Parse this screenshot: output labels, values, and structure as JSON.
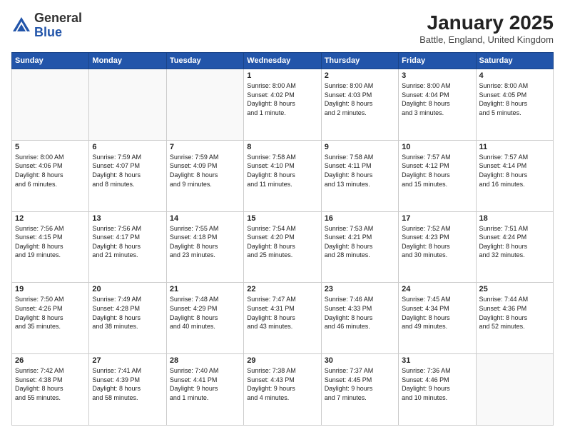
{
  "header": {
    "logo_general": "General",
    "logo_blue": "Blue",
    "month_title": "January 2025",
    "location": "Battle, England, United Kingdom"
  },
  "weekdays": [
    "Sunday",
    "Monday",
    "Tuesday",
    "Wednesday",
    "Thursday",
    "Friday",
    "Saturday"
  ],
  "weeks": [
    [
      {
        "day": "",
        "info": ""
      },
      {
        "day": "",
        "info": ""
      },
      {
        "day": "",
        "info": ""
      },
      {
        "day": "1",
        "info": "Sunrise: 8:00 AM\nSunset: 4:02 PM\nDaylight: 8 hours\nand 1 minute."
      },
      {
        "day": "2",
        "info": "Sunrise: 8:00 AM\nSunset: 4:03 PM\nDaylight: 8 hours\nand 2 minutes."
      },
      {
        "day": "3",
        "info": "Sunrise: 8:00 AM\nSunset: 4:04 PM\nDaylight: 8 hours\nand 3 minutes."
      },
      {
        "day": "4",
        "info": "Sunrise: 8:00 AM\nSunset: 4:05 PM\nDaylight: 8 hours\nand 5 minutes."
      }
    ],
    [
      {
        "day": "5",
        "info": "Sunrise: 8:00 AM\nSunset: 4:06 PM\nDaylight: 8 hours\nand 6 minutes."
      },
      {
        "day": "6",
        "info": "Sunrise: 7:59 AM\nSunset: 4:07 PM\nDaylight: 8 hours\nand 8 minutes."
      },
      {
        "day": "7",
        "info": "Sunrise: 7:59 AM\nSunset: 4:09 PM\nDaylight: 8 hours\nand 9 minutes."
      },
      {
        "day": "8",
        "info": "Sunrise: 7:58 AM\nSunset: 4:10 PM\nDaylight: 8 hours\nand 11 minutes."
      },
      {
        "day": "9",
        "info": "Sunrise: 7:58 AM\nSunset: 4:11 PM\nDaylight: 8 hours\nand 13 minutes."
      },
      {
        "day": "10",
        "info": "Sunrise: 7:57 AM\nSunset: 4:12 PM\nDaylight: 8 hours\nand 15 minutes."
      },
      {
        "day": "11",
        "info": "Sunrise: 7:57 AM\nSunset: 4:14 PM\nDaylight: 8 hours\nand 16 minutes."
      }
    ],
    [
      {
        "day": "12",
        "info": "Sunrise: 7:56 AM\nSunset: 4:15 PM\nDaylight: 8 hours\nand 19 minutes."
      },
      {
        "day": "13",
        "info": "Sunrise: 7:56 AM\nSunset: 4:17 PM\nDaylight: 8 hours\nand 21 minutes."
      },
      {
        "day": "14",
        "info": "Sunrise: 7:55 AM\nSunset: 4:18 PM\nDaylight: 8 hours\nand 23 minutes."
      },
      {
        "day": "15",
        "info": "Sunrise: 7:54 AM\nSunset: 4:20 PM\nDaylight: 8 hours\nand 25 minutes."
      },
      {
        "day": "16",
        "info": "Sunrise: 7:53 AM\nSunset: 4:21 PM\nDaylight: 8 hours\nand 28 minutes."
      },
      {
        "day": "17",
        "info": "Sunrise: 7:52 AM\nSunset: 4:23 PM\nDaylight: 8 hours\nand 30 minutes."
      },
      {
        "day": "18",
        "info": "Sunrise: 7:51 AM\nSunset: 4:24 PM\nDaylight: 8 hours\nand 32 minutes."
      }
    ],
    [
      {
        "day": "19",
        "info": "Sunrise: 7:50 AM\nSunset: 4:26 PM\nDaylight: 8 hours\nand 35 minutes."
      },
      {
        "day": "20",
        "info": "Sunrise: 7:49 AM\nSunset: 4:28 PM\nDaylight: 8 hours\nand 38 minutes."
      },
      {
        "day": "21",
        "info": "Sunrise: 7:48 AM\nSunset: 4:29 PM\nDaylight: 8 hours\nand 40 minutes."
      },
      {
        "day": "22",
        "info": "Sunrise: 7:47 AM\nSunset: 4:31 PM\nDaylight: 8 hours\nand 43 minutes."
      },
      {
        "day": "23",
        "info": "Sunrise: 7:46 AM\nSunset: 4:33 PM\nDaylight: 8 hours\nand 46 minutes."
      },
      {
        "day": "24",
        "info": "Sunrise: 7:45 AM\nSunset: 4:34 PM\nDaylight: 8 hours\nand 49 minutes."
      },
      {
        "day": "25",
        "info": "Sunrise: 7:44 AM\nSunset: 4:36 PM\nDaylight: 8 hours\nand 52 minutes."
      }
    ],
    [
      {
        "day": "26",
        "info": "Sunrise: 7:42 AM\nSunset: 4:38 PM\nDaylight: 8 hours\nand 55 minutes."
      },
      {
        "day": "27",
        "info": "Sunrise: 7:41 AM\nSunset: 4:39 PM\nDaylight: 8 hours\nand 58 minutes."
      },
      {
        "day": "28",
        "info": "Sunrise: 7:40 AM\nSunset: 4:41 PM\nDaylight: 9 hours\nand 1 minute."
      },
      {
        "day": "29",
        "info": "Sunrise: 7:38 AM\nSunset: 4:43 PM\nDaylight: 9 hours\nand 4 minutes."
      },
      {
        "day": "30",
        "info": "Sunrise: 7:37 AM\nSunset: 4:45 PM\nDaylight: 9 hours\nand 7 minutes."
      },
      {
        "day": "31",
        "info": "Sunrise: 7:36 AM\nSunset: 4:46 PM\nDaylight: 9 hours\nand 10 minutes."
      },
      {
        "day": "",
        "info": ""
      }
    ]
  ]
}
